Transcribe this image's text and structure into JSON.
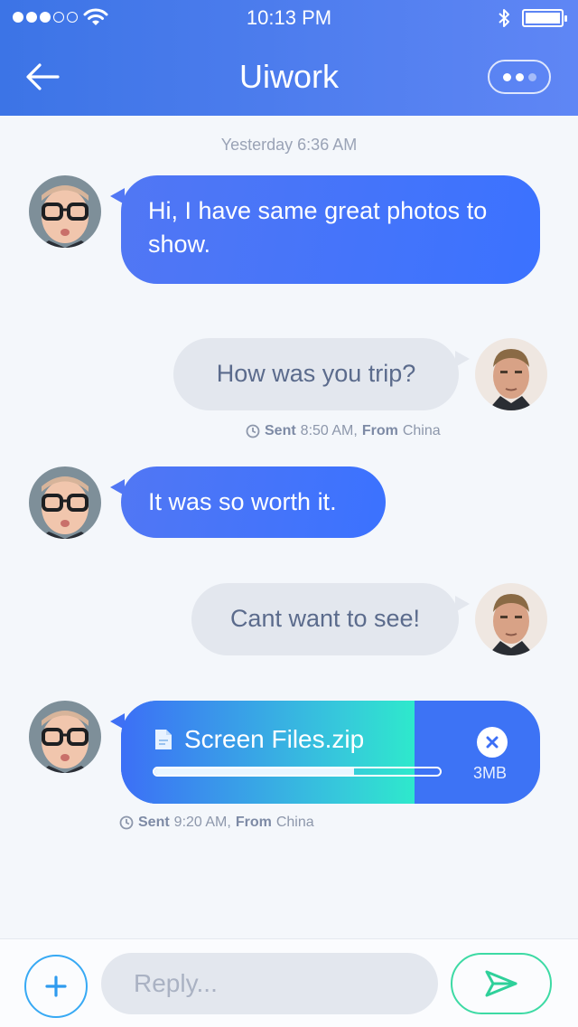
{
  "status_bar": {
    "time": "10:13 PM",
    "signal_bars_filled": 3,
    "signal_bars_total": 5
  },
  "header": {
    "title": "Uiwork",
    "back_icon": "arrow-left-icon",
    "more_icon": "ellipsis-icon"
  },
  "conversation": {
    "timestamp": "Yesterday 6:36 AM",
    "messages": [
      {
        "direction": "in",
        "text": "Hi, I have same great photos to show."
      },
      {
        "direction": "out",
        "text": "How was you trip?",
        "meta": {
          "sent_label": "Sent",
          "time": "8:50 AM,",
          "from_label": "From",
          "location": "China"
        }
      },
      {
        "direction": "in",
        "text": "It was so worth it."
      },
      {
        "direction": "out",
        "text": "Cant want to see!"
      }
    ],
    "file": {
      "name": "Screen Files.zip",
      "size": "3MB",
      "progress": 0.7,
      "meta": {
        "sent_label": "Sent",
        "time": "9:20 AM,",
        "from_label": "From",
        "location": "China"
      }
    }
  },
  "composer": {
    "placeholder": "Reply...",
    "value": ""
  },
  "colors": {
    "accent": "#3c74e6",
    "send": "#3ddaa4",
    "plus": "#37a9f4"
  }
}
